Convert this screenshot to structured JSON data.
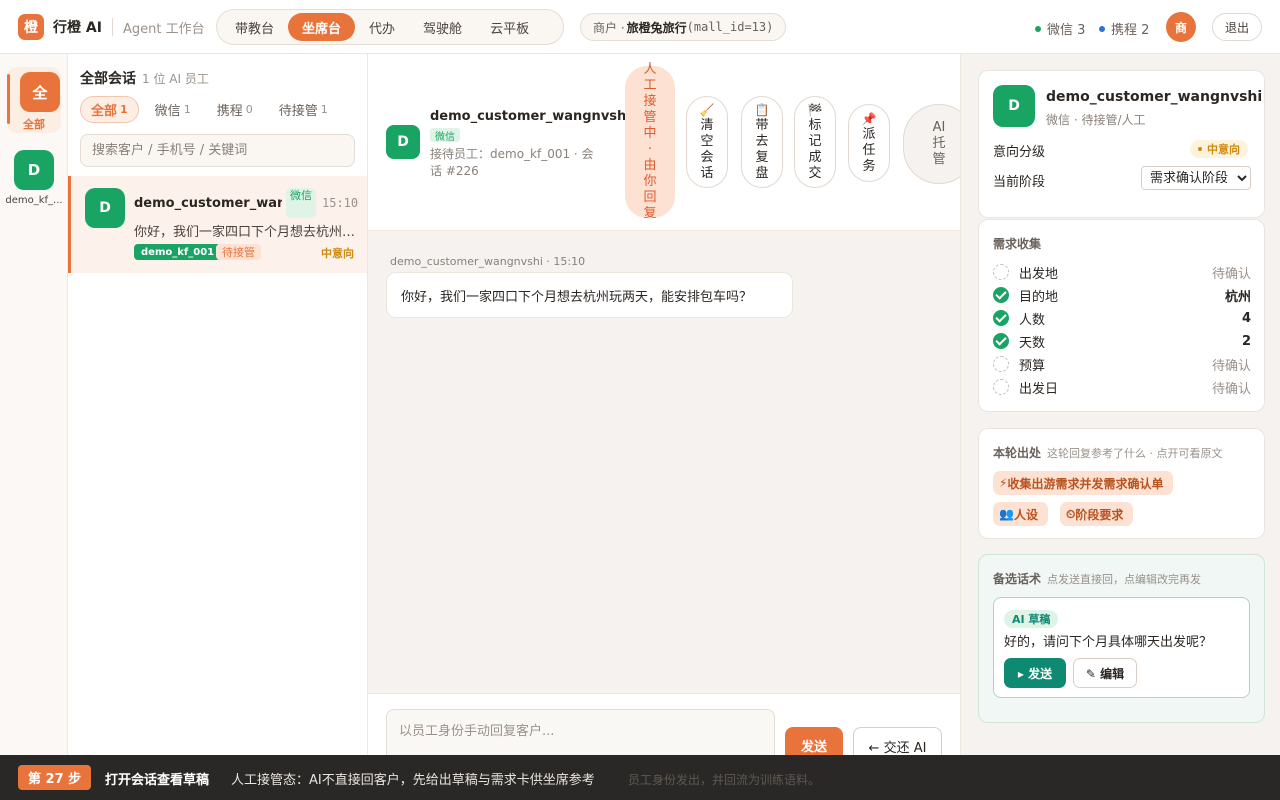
{
  "app": {
    "logo_char": "橙",
    "name": "行橙 AI",
    "subtitle": "Agent 工作台"
  },
  "nav": {
    "tabs": [
      {
        "label": "带教台",
        "active": false
      },
      {
        "label": "坐席台",
        "active": true
      },
      {
        "label": "代办",
        "active": false
      },
      {
        "label": "驾驶舱",
        "active": false
      },
      {
        "label": "云平板",
        "active": false
      }
    ]
  },
  "merchant": {
    "prefix": "商户 · ",
    "name": "旅橙兔旅行",
    "id": "(mall_id=13)"
  },
  "channels": [
    {
      "label": "微信 3",
      "color": "#19a463"
    },
    {
      "label": "携程 2",
      "color": "#2f6fd8"
    }
  ],
  "user": {
    "avatar_char": "商",
    "logout_label": "退出"
  },
  "rail": {
    "all_char": "全",
    "all_label": "全部",
    "agent_char": "D",
    "agent_label": "demo_kf_..."
  },
  "conv_list": {
    "title": "全部会话",
    "subtitle": "1 位 AI 员工",
    "filters": [
      {
        "label": "全部",
        "count": "1",
        "active": true
      },
      {
        "label": "微信",
        "count": "1",
        "active": false
      },
      {
        "label": "携程",
        "count": "0",
        "active": false
      },
      {
        "label": "待接管",
        "count": "1",
        "active": false
      }
    ],
    "search_placeholder": "搜索客户 / 手机号 / 关键词",
    "items": [
      {
        "avatar_char": "D",
        "name": "demo_customer_wangn",
        "channel": "微信",
        "time": "15:10",
        "preview": "你好，我们一家四口下个月想去杭州玩两天，能安排包车吗？",
        "agent_tag": "demo_kf_001",
        "status_tag": "待接管",
        "intent": "中意向"
      }
    ]
  },
  "chat": {
    "avatar_char": "D",
    "name": "demo_customer_wangnvshi",
    "channel_badge": "微信",
    "meta": "接待员工：demo_kf_001 · 会话 #226",
    "takeover_notice": "人工接管中·由你回复",
    "actions": [
      {
        "icon": "broom-icon",
        "glyph": "🧹",
        "label": "清空会话"
      },
      {
        "icon": "clipboard-icon",
        "glyph": "📋",
        "label": "带去复盘"
      },
      {
        "icon": "flag-icon",
        "glyph": "🏁",
        "label": "标记成交"
      },
      {
        "icon": "pin-icon",
        "glyph": "📌",
        "label": "派任务"
      }
    ],
    "ai_hosting_label": "AI托管",
    "messages": [
      {
        "meta": "demo_customer_wangnvshi · 15:10",
        "text": "你好，我们一家四口下个月想去杭州玩两天，能安排包车吗？"
      }
    ],
    "composer": {
      "placeholder": "以员工身份手动回复客户...",
      "send_label": "发送",
      "handback_label": "← 交还 AI"
    }
  },
  "profile": {
    "avatar_char": "D",
    "name": "demo_customer_wangnvshi",
    "sub": "微信 · 待接管/人工",
    "intent_label": "意向分级",
    "intent_value": "中意向",
    "stage_label": "当前阶段",
    "stage_value": "需求确认阶段"
  },
  "requirements": {
    "title": "需求收集",
    "items": [
      {
        "label": "出发地",
        "value": "待确认",
        "done": false
      },
      {
        "label": "目的地",
        "value": "杭州",
        "done": true
      },
      {
        "label": "人数",
        "value": "4",
        "done": true
      },
      {
        "label": "天数",
        "value": "2",
        "done": true
      },
      {
        "label": "预算",
        "value": "待确认",
        "done": false
      },
      {
        "label": "出发日",
        "value": "待确认",
        "done": false
      }
    ]
  },
  "sources": {
    "title": "本轮出处",
    "hint": "这轮回复参考了什么 · 点开可看原文",
    "refs": [
      {
        "icon": "lightning-icon",
        "glyph": "⚡",
        "label": "收集出游需求并发需求确认单"
      },
      {
        "icon": "persona-icon",
        "glyph": "👥",
        "label": "人设"
      },
      {
        "icon": "clock-icon",
        "glyph": "⏲",
        "label": "阶段要求"
      }
    ]
  },
  "drafts": {
    "title": "备选话术",
    "hint": "点发送直接回，点编辑改完再发",
    "items": [
      {
        "tag": "AI 草稿",
        "text": "好的，请问下个月具体哪天出发呢？",
        "send_label": "▸ 发送",
        "edit_label": "✎ 编辑"
      }
    ]
  },
  "stepbar": {
    "step": "第 27 步",
    "title": "打开会话查看草稿",
    "desc": "人工接管态：AI不直接回客户，先给出草稿与需求卡供坐席参考",
    "ghost": "员工身份发出，并回流为训练语料。"
  }
}
